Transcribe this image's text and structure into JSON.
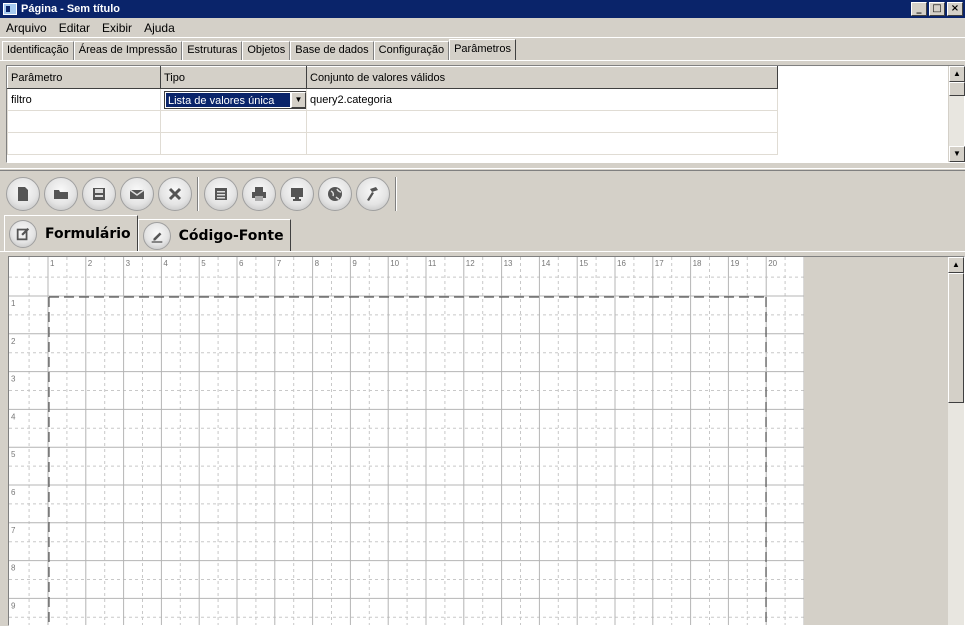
{
  "window": {
    "title": "Página - Sem título",
    "controls": [
      "minimize-icon",
      "maximize-icon",
      "close-icon"
    ]
  },
  "menu": [
    "Arquivo",
    "Editar",
    "Exibir",
    "Ajuda"
  ],
  "top_tabs": [
    {
      "label": "Identificação",
      "active": false
    },
    {
      "label": "Áreas de Impressão",
      "active": false
    },
    {
      "label": "Estruturas",
      "active": false
    },
    {
      "label": "Objetos",
      "active": false
    },
    {
      "label": "Base de dados",
      "active": false
    },
    {
      "label": "Configuração",
      "active": false
    },
    {
      "label": "Parâmetros",
      "active": true
    }
  ],
  "param_table": {
    "headers": [
      "Parâmetro",
      "Tipo",
      "Conjunto de valores válidos"
    ],
    "rows": [
      {
        "parametro": "filtro",
        "tipo": "Lista de valores única",
        "conjunto": "query2.categoria"
      }
    ]
  },
  "toolbar_icons": [
    "new-document-icon",
    "open-folder-icon",
    "save-icon",
    "email-icon",
    "delete-icon",
    "form-icon",
    "print-icon",
    "monitor-icon",
    "globe-icon",
    "hammer-icon"
  ],
  "editor_tabs": [
    {
      "label": "Formulário",
      "icon": "form-edit-icon",
      "active": true
    },
    {
      "label": "Código-Fonte",
      "icon": "pencil-icon",
      "active": false
    }
  ],
  "ruler": {
    "top": [
      "1",
      "2",
      "3",
      "4",
      "5",
      "6",
      "7",
      "8",
      "9",
      "10",
      "11",
      "12",
      "13",
      "14",
      "15",
      "16",
      "17",
      "18",
      "19",
      "20"
    ],
    "left": [
      "1",
      "2",
      "3",
      "4",
      "5",
      "6",
      "7",
      "8",
      "9"
    ]
  },
  "colors": {
    "title_bar": "#0a246a",
    "face": "#d4d0c8",
    "selection": "#0a246a"
  }
}
